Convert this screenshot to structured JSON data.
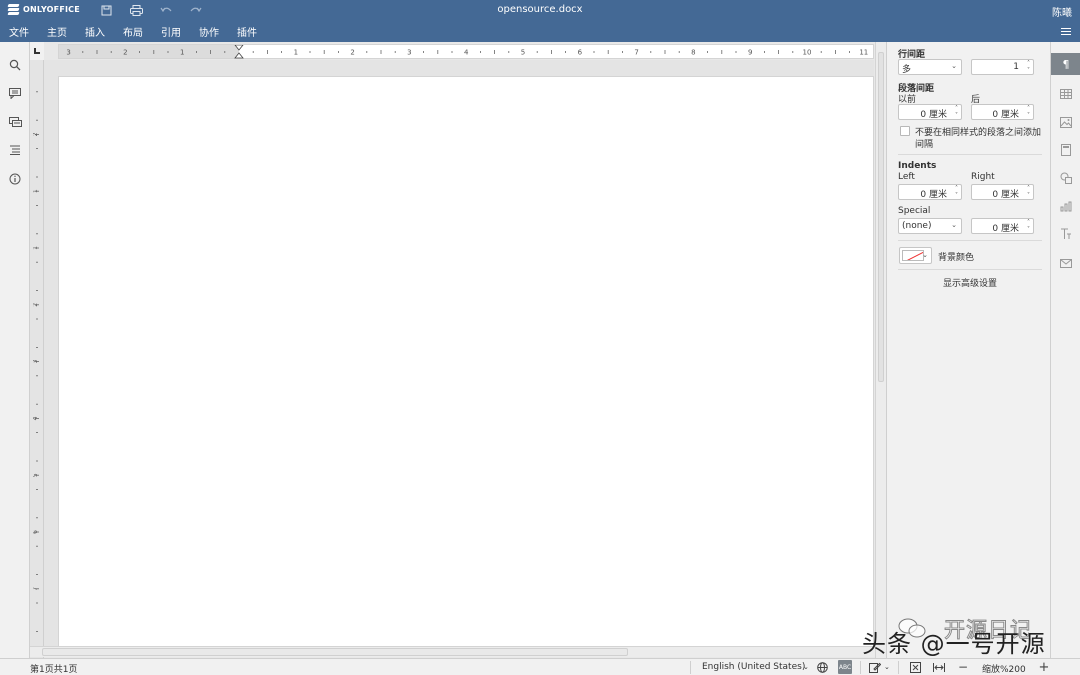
{
  "header": {
    "brand": "ONLYOFFICE",
    "document_title": "opensource.docx",
    "user_name": "陈曦",
    "menu": [
      "文件",
      "主页",
      "插入",
      "布局",
      "引用",
      "协作",
      "插件"
    ]
  },
  "ruler": {
    "horizontal_labels": [
      "3",
      "2",
      "1",
      "1",
      "2",
      "3",
      "4",
      "5",
      "6",
      "7",
      "8",
      "9",
      "10",
      "11"
    ],
    "vertical_labels": [
      "1",
      "2",
      "1",
      "1",
      "2",
      "3",
      "4",
      "5",
      "6",
      "7"
    ]
  },
  "paragraph_panel": {
    "line_spacing_label": "行间距",
    "line_spacing_type": "多",
    "line_spacing_value": "1",
    "paragraph_spacing_label": "段落间距",
    "before_label": "以前",
    "after_label": "后",
    "before_value": "0 厘米",
    "after_value": "0 厘米",
    "dont_add_interval_label_line1": "不要在相同样式的段落之间添加",
    "dont_add_interval_label_line2": "间隔",
    "indents_label": "Indents",
    "left_label": "Left",
    "right_label": "Right",
    "left_value": "0 厘米",
    "right_value": "0 厘米",
    "special_label": "Special",
    "special_value": "(none)",
    "special_by_value": "0 厘米",
    "background_color_label": "背景颜色",
    "advanced_settings_label": "显示高级设置"
  },
  "status_bar": {
    "page_info": "第1页共1页",
    "language": "English (United States)",
    "zoom": "缩放%200"
  },
  "watermark": {
    "line1": "开源日记",
    "line2": "头条 @一号开源"
  },
  "colors": {
    "header_bg": "#446995",
    "panel_bg": "#f1f1f1",
    "active_tab": "#7d858c"
  }
}
